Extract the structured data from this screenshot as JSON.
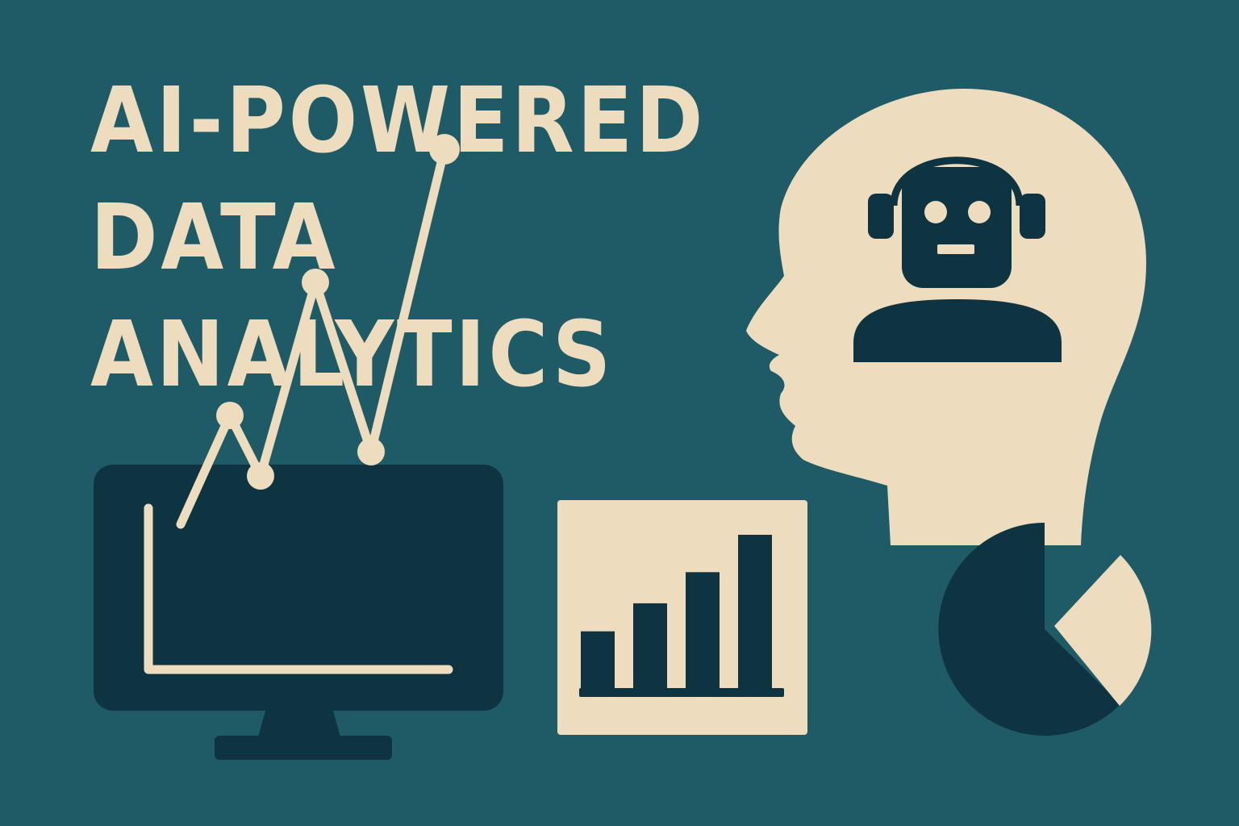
{
  "headline": {
    "lines": [
      "AI-POWERED",
      "DATA",
      "ANALYTICS"
    ]
  },
  "colors": {
    "background": "#1f5b66",
    "cream": "#eddcbd",
    "navy": "#0d3440"
  },
  "icons": {
    "monitor": "monitor-icon",
    "line_chart": "line-chart-icon",
    "bar_chart": "bar-chart-icon",
    "head": "human-head-icon",
    "robot": "robot-icon",
    "pie_chart": "pie-chart-icon"
  },
  "line_chart_values": [
    2.2,
    3.1,
    2.6,
    4.2,
    2.8,
    5.3
  ],
  "bar_chart_values": [
    0.38,
    0.56,
    0.76,
    1.0
  ]
}
